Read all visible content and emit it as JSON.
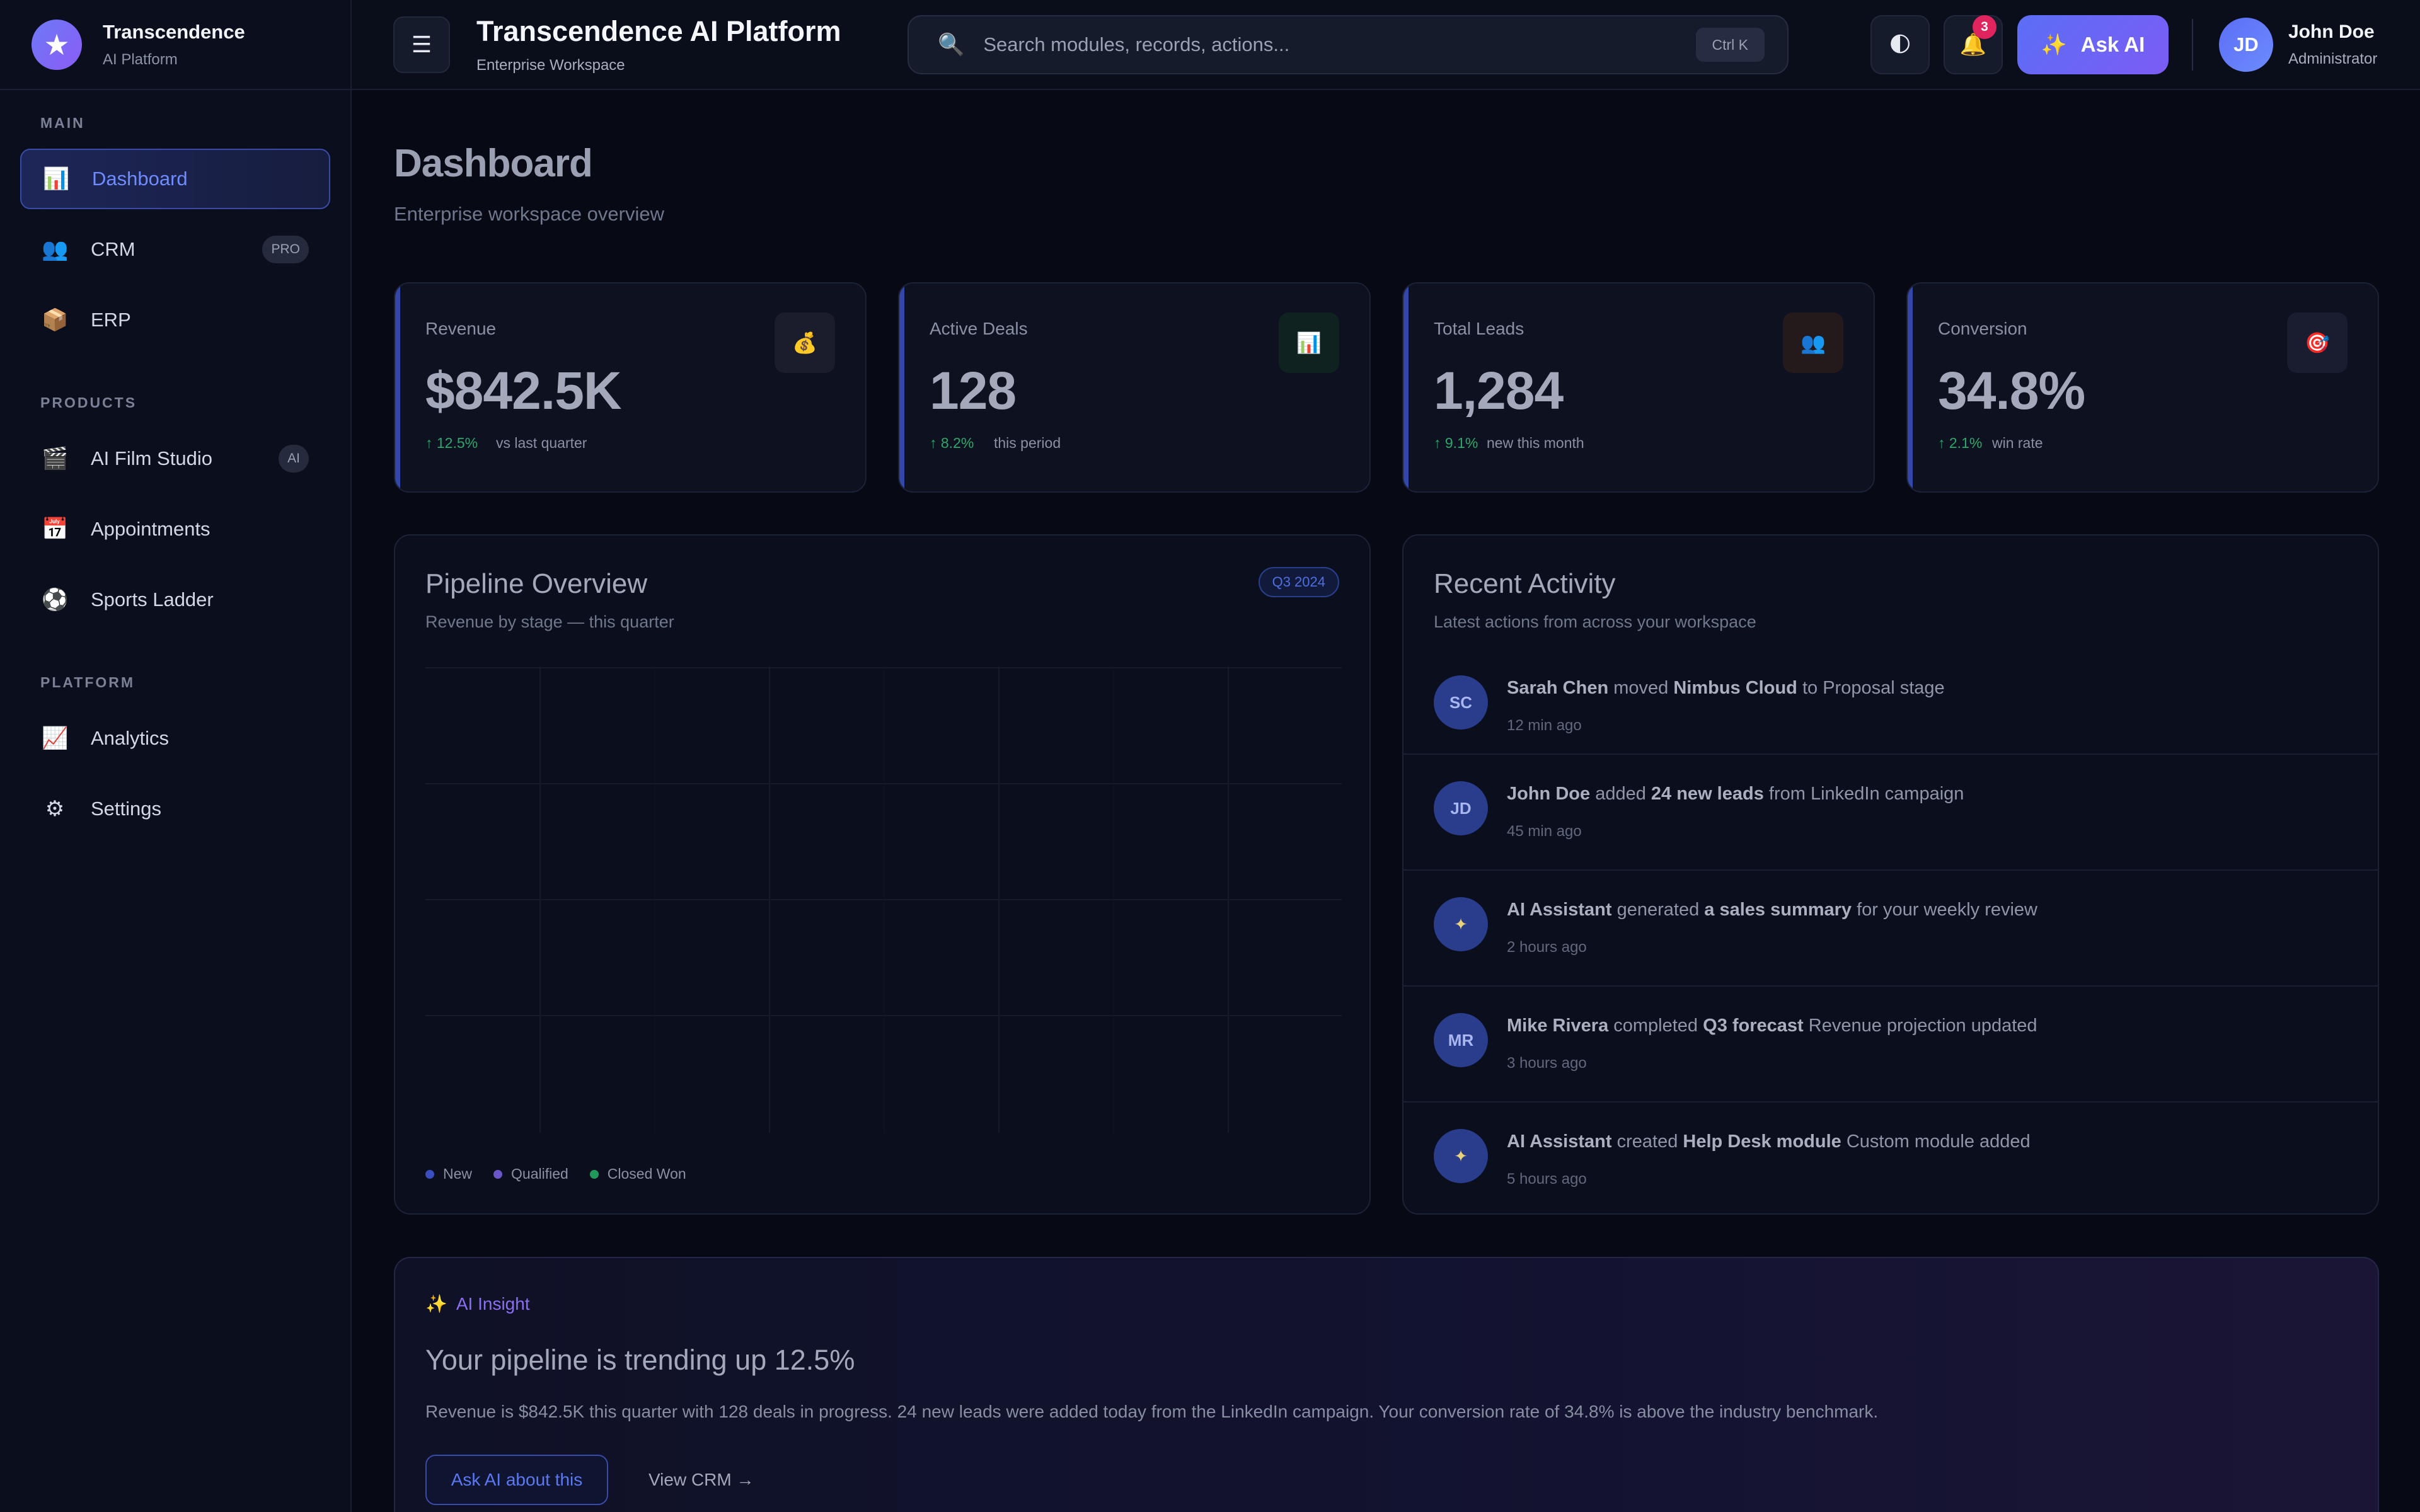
{
  "brand": {
    "name": "Transcendence",
    "subtitle": "AI Platform",
    "logo_icon": "star-icon"
  },
  "sidebar": {
    "sections": [
      {
        "heading": "MAIN"
      },
      {
        "heading": "PRODUCTS"
      },
      {
        "heading": "PLATFORM"
      }
    ],
    "items": [
      {
        "label": "Dashboard",
        "icon": "bar-chart-icon",
        "active": true
      },
      {
        "label": "CRM",
        "icon": "people-icon",
        "badge": "PRO"
      },
      {
        "label": "ERP",
        "icon": "package-icon"
      },
      {
        "label": "AI Film Studio",
        "icon": "clapper-icon",
        "badge": "AI"
      },
      {
        "label": "Appointments",
        "icon": "calendar-icon"
      },
      {
        "label": "Sports Ladder",
        "icon": "soccer-ball-icon"
      },
      {
        "label": "Analytics",
        "icon": "line-chart-icon"
      },
      {
        "label": "Settings",
        "icon": "gear-icon"
      }
    ]
  },
  "header": {
    "title": "Transcendence AI Platform",
    "workspace": "Enterprise Workspace",
    "search": {
      "placeholder": "Search modules, records, actions...",
      "shortcut": "Ctrl K"
    },
    "notifications": "3",
    "ask_ai": "Ask AI",
    "user": {
      "initials": "JD",
      "name": "John Doe",
      "role": "Administrator"
    }
  },
  "page": {
    "title": "Dashboard",
    "subtitle": "Enterprise workspace overview"
  },
  "kpis": [
    {
      "label": "Revenue",
      "value": "$842.5K",
      "delta": "↑ 12.5%",
      "note": "vs last quarter",
      "icon": "money-bag-icon"
    },
    {
      "label": "Active Deals",
      "value": "128",
      "delta": "↑ 8.2%",
      "note": "this period",
      "icon": "bar-chart-icon"
    },
    {
      "label": "Total Leads",
      "value": "1,284",
      "delta": "↑ 9.1%",
      "note": "new this month",
      "icon": "people-icon"
    },
    {
      "label": "Conversion",
      "value": "34.8%",
      "delta": "↑ 2.1%",
      "note": "win rate",
      "icon": "target-icon"
    }
  ],
  "pipeline": {
    "title": "Pipeline Overview",
    "subtitle": "Revenue by stage — this quarter",
    "period": "Q3 2024",
    "legend": [
      {
        "name": "New",
        "color": "#3a4ec0"
      },
      {
        "name": "Qualified",
        "color": "#6a55c9"
      },
      {
        "name": "Closed Won",
        "color": "#1f9a5a"
      }
    ]
  },
  "activity": {
    "title": "Recent Activity",
    "subtitle": "Latest actions from across your workspace",
    "items": [
      {
        "avatar": "SC",
        "actor": "Sarah Chen",
        "verb": "moved",
        "object": "Nimbus Cloud",
        "rest": "to Proposal stage",
        "time": "12 min ago"
      },
      {
        "avatar": "JD",
        "actor": "John Doe",
        "verb": "added",
        "object": "24 new leads",
        "rest": "from LinkedIn campaign",
        "time": "45 min ago"
      },
      {
        "avatar": "✦",
        "actor": "AI Assistant",
        "verb": "generated",
        "object": "a sales summary",
        "rest": "for your weekly review",
        "time": "2 hours ago"
      },
      {
        "avatar": "MR",
        "actor": "Mike Rivera",
        "verb": "completed",
        "object": "Q3 forecast",
        "rest": "Revenue projection updated",
        "time": "3 hours ago"
      },
      {
        "avatar": "✦",
        "actor": "AI Assistant",
        "verb": "created",
        "object": "Help Desk module",
        "rest": "Custom module added",
        "time": "5 hours ago"
      }
    ]
  },
  "insight": {
    "tag": "AI Insight",
    "title": "Your pipeline is trending up 12.5%",
    "body": "Revenue is $842.5K this quarter with 128 deals in progress. 24 new leads were added today from the LinkedIn campaign. Your conversion rate of 34.8% is above the industry benchmark.",
    "primary_action": "Ask AI about this",
    "secondary_action": "View CRM →"
  }
}
